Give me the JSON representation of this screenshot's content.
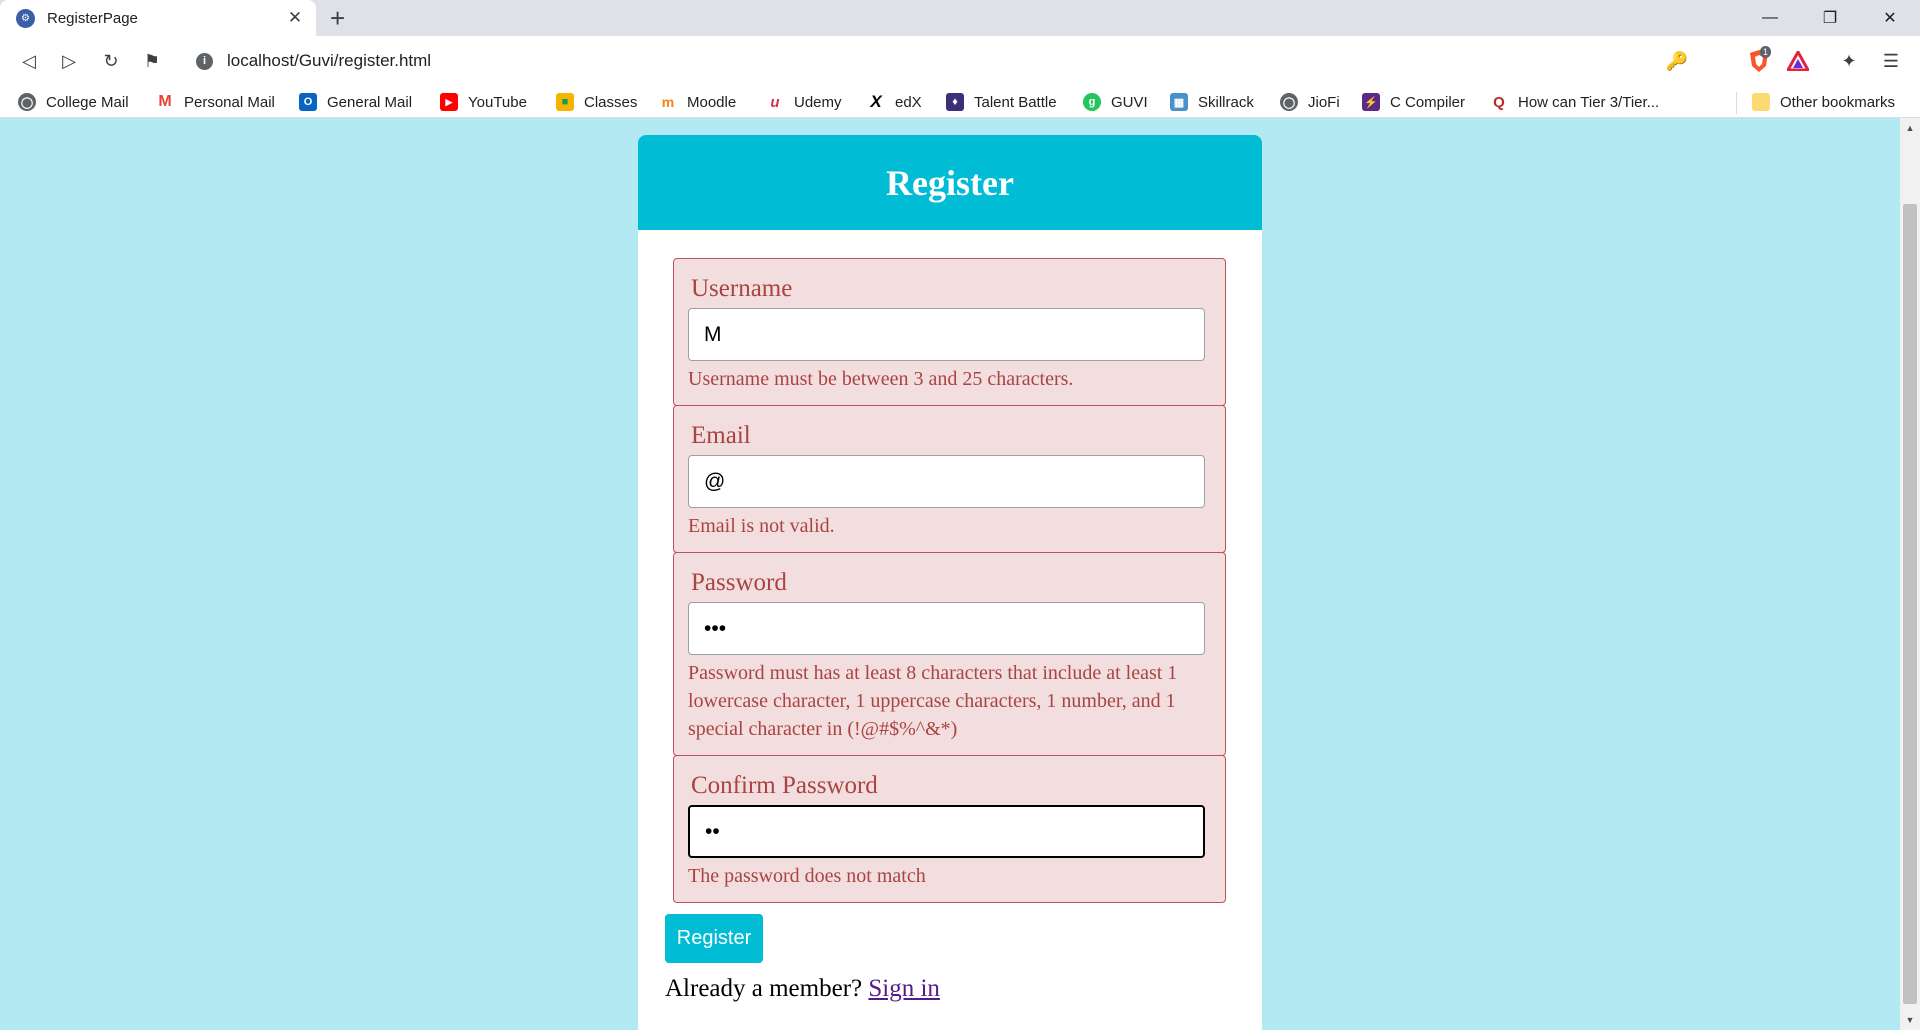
{
  "browser": {
    "tab_title": "RegisterPage",
    "new_tab_symbol": "+",
    "url": "localhost/Guvi/register.html",
    "brave_badge": "1",
    "bookmarks": [
      {
        "label": "College Mail",
        "icon": "globe-icon"
      },
      {
        "label": "Personal Mail",
        "icon": "gmail-icon"
      },
      {
        "label": "General Mail",
        "icon": "outlook-icon"
      },
      {
        "label": "YouTube",
        "icon": "youtube-icon"
      },
      {
        "label": "Classes",
        "icon": "classroom-icon"
      },
      {
        "label": "Moodle",
        "icon": "moodle-icon"
      },
      {
        "label": "Udemy",
        "icon": "udemy-icon"
      },
      {
        "label": "edX",
        "icon": "edx-icon"
      },
      {
        "label": "Talent Battle",
        "icon": "talent-battle-icon"
      },
      {
        "label": "GUVI",
        "icon": "guvi-icon"
      },
      {
        "label": "Skillrack",
        "icon": "skillrack-icon"
      },
      {
        "label": "JioFi",
        "icon": "globe-icon"
      },
      {
        "label": "C Compiler",
        "icon": "compiler-icon"
      },
      {
        "label": "How can Tier 3/Tier...",
        "icon": "quora-icon"
      }
    ],
    "other_bookmarks": "Other bookmarks"
  },
  "form": {
    "title": "Register",
    "fields": [
      {
        "label": "Username",
        "value": "M",
        "error": "Username must be between 3 and 25 characters."
      },
      {
        "label": "Email",
        "value": "@",
        "error": "Email is not valid."
      },
      {
        "label": "Password",
        "value": "•••",
        "error": "Password must has at least 8 characters that include at least 1 lowercase character, 1 uppercase characters, 1 number, and 1 special character in (!@#$%^&*)"
      },
      {
        "label": "Confirm Password",
        "value": "••",
        "error": "The password does not match"
      }
    ],
    "submit_label": "Register",
    "member_prompt": "Already a member?",
    "signin_label": "Sign in"
  },
  "colors": {
    "page_background": "#b3e9f2",
    "accent": "#00bcd4",
    "error_text": "#a94442",
    "error_background": "#f2dede"
  }
}
